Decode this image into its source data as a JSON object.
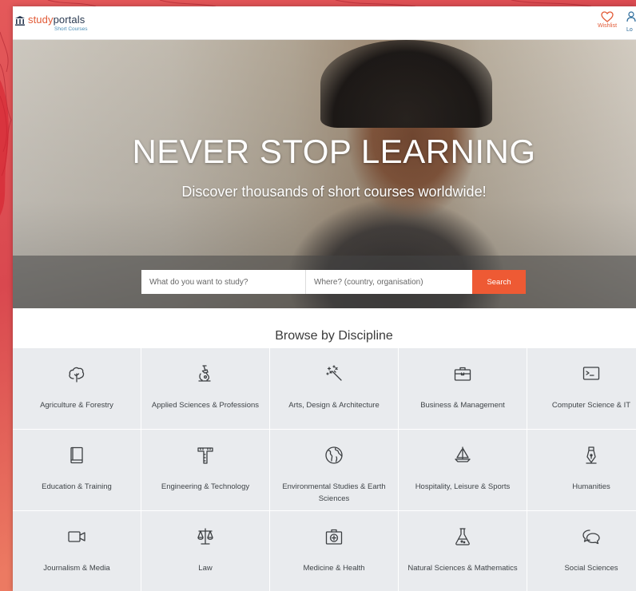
{
  "header": {
    "logo_study": "study",
    "logo_portals": "portals",
    "logo_sub": "Short Courses",
    "wishlist_label": "Wishlist",
    "login_label": "Lo"
  },
  "hero": {
    "title": "NEVER STOP LEARNING",
    "subtitle": "Discover thousands of short courses worldwide!",
    "search_what_placeholder": "What do you want to study?",
    "search_where_placeholder": "Where? (country, organisation)",
    "search_button": "Search"
  },
  "browse": {
    "title": "Browse by Discipline",
    "disciplines": [
      {
        "label": "Agriculture & Forestry",
        "icon": "tree-icon"
      },
      {
        "label": "Applied Sciences & Professions",
        "icon": "microscope-icon"
      },
      {
        "label": "Arts, Design & Architecture",
        "icon": "magic-wand-icon"
      },
      {
        "label": "Business & Management",
        "icon": "briefcase-icon"
      },
      {
        "label": "Computer Science & IT",
        "icon": "terminal-icon"
      },
      {
        "label": "Education & Training",
        "icon": "book-icon"
      },
      {
        "label": "Engineering & Technology",
        "icon": "t-square-icon"
      },
      {
        "label": "Environmental Studies & Earth Sciences",
        "icon": "globe-icon"
      },
      {
        "label": "Hospitality, Leisure & Sports",
        "icon": "sailboat-icon"
      },
      {
        "label": "Humanities",
        "icon": "fountain-pen-icon"
      },
      {
        "label": "Journalism & Media",
        "icon": "video-camera-icon"
      },
      {
        "label": "Law",
        "icon": "scales-icon"
      },
      {
        "label": "Medicine & Health",
        "icon": "first-aid-kit-icon"
      },
      {
        "label": "Natural Sciences & Mathematics",
        "icon": "flask-icon"
      },
      {
        "label": "Social Sciences",
        "icon": "speech-bubbles-icon"
      }
    ]
  },
  "colors": {
    "accent": "#ee5a34",
    "tile_bg": "#e9ebee",
    "page_bg": "#e4595a"
  }
}
